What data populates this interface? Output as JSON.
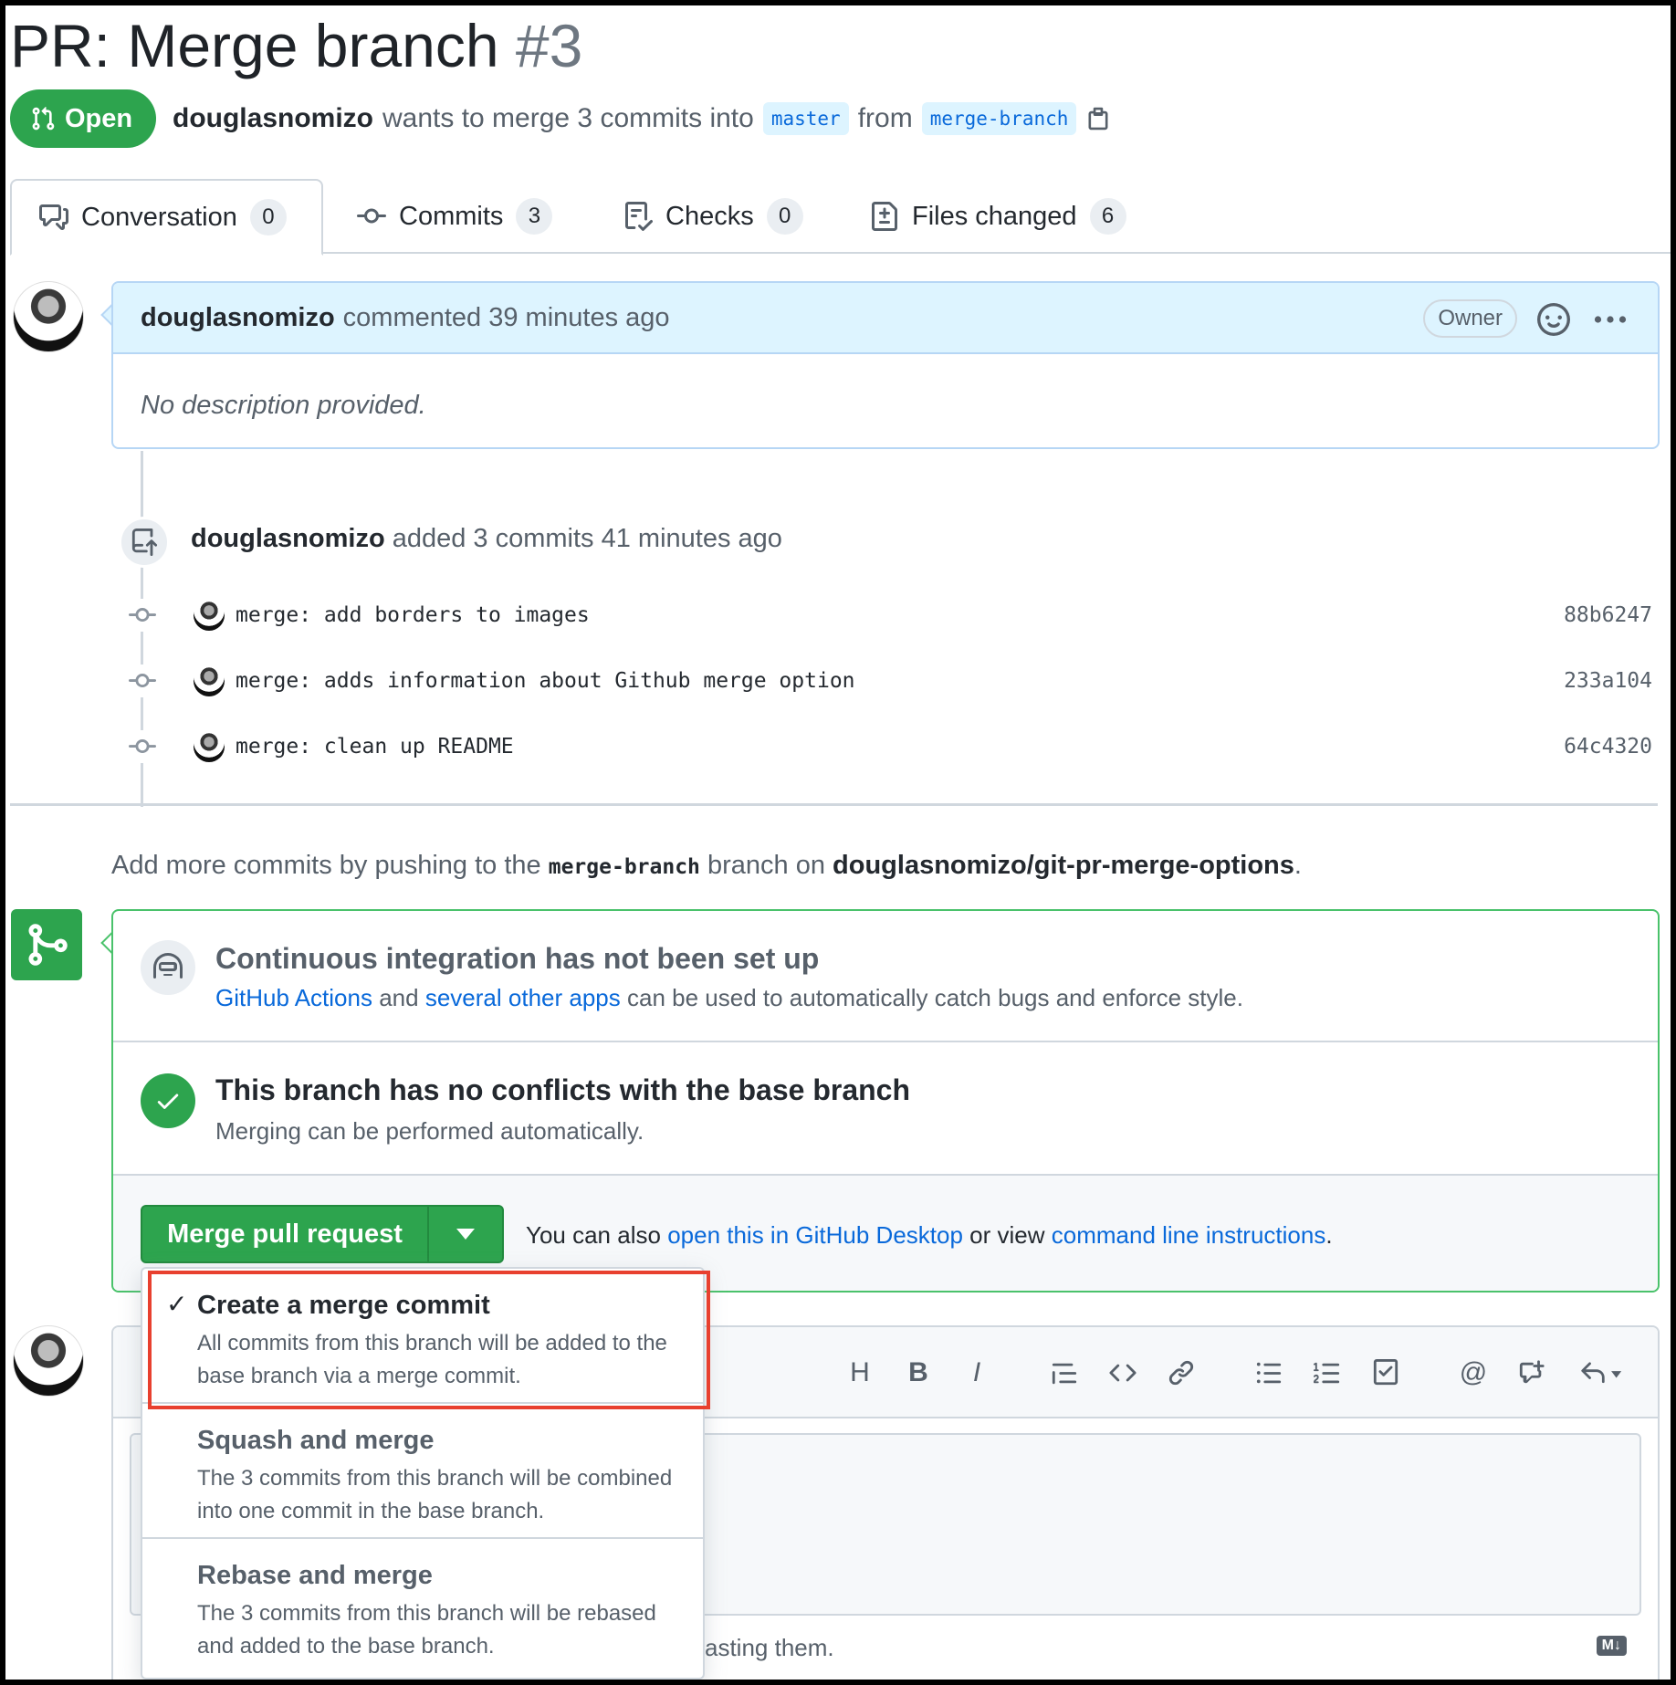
{
  "header": {
    "title": "PR: Merge branch",
    "number": "#3",
    "status": "Open",
    "author": "douglasnomizo",
    "merge_text": "wants to merge 3 commits into",
    "base_branch": "master",
    "from_text": "from",
    "head_branch": "merge-branch"
  },
  "tabs": [
    {
      "label": "Conversation",
      "count": "0"
    },
    {
      "label": "Commits",
      "count": "3"
    },
    {
      "label": "Checks",
      "count": "0"
    },
    {
      "label": "Files changed",
      "count": "6"
    }
  ],
  "comment": {
    "author": "douglasnomizo",
    "meta": "commented 39 minutes ago",
    "role": "Owner",
    "body": "No description provided."
  },
  "push_event": {
    "author": "douglasnomizo",
    "text": "added 3 commits 41 minutes ago"
  },
  "commits": [
    {
      "message": "merge: add borders to images",
      "sha": "88b6247"
    },
    {
      "message": "merge: adds information about Github merge option",
      "sha": "233a104"
    },
    {
      "message": "merge: clean up README",
      "sha": "64c4320"
    }
  ],
  "add_more": {
    "prefix": "Add more commits by pushing to the",
    "branch": "merge-branch",
    "middle": "branch on",
    "repo": "douglasnomizo/git-pr-merge-options",
    "suffix": "."
  },
  "ci": {
    "title": "Continuous integration has not been set up",
    "link1": "GitHub Actions",
    "and_text": "and",
    "link2": "several other apps",
    "rest": "can be used to automatically catch bugs and enforce style."
  },
  "conflicts": {
    "title": "This branch has no conflicts with the base branch",
    "subtitle": "Merging can be performed automatically."
  },
  "merge": {
    "button_label": "Merge pull request",
    "alt_prefix": "You can also",
    "alt_link1": "open this in GitHub Desktop",
    "alt_middle": "or view",
    "alt_link2": "command line instructions",
    "alt_suffix": "."
  },
  "merge_options": [
    {
      "title": "Create a merge commit",
      "description": "All commits from this branch will be added to the base branch via a merge commit.",
      "selected": true
    },
    {
      "title": "Squash and merge",
      "description": "The 3 commits from this branch will be combined into one commit in the base branch.",
      "selected": false
    },
    {
      "title": "Rebase and merge",
      "description": "The 3 commits from this branch will be rebased and added to the base branch.",
      "selected": false
    }
  ],
  "editor": {
    "hint": "asting them.",
    "markdown_badge": "M↓"
  },
  "colors": {
    "green": "#2da44e",
    "link": "#0969da",
    "highlight": "#e8402f"
  }
}
